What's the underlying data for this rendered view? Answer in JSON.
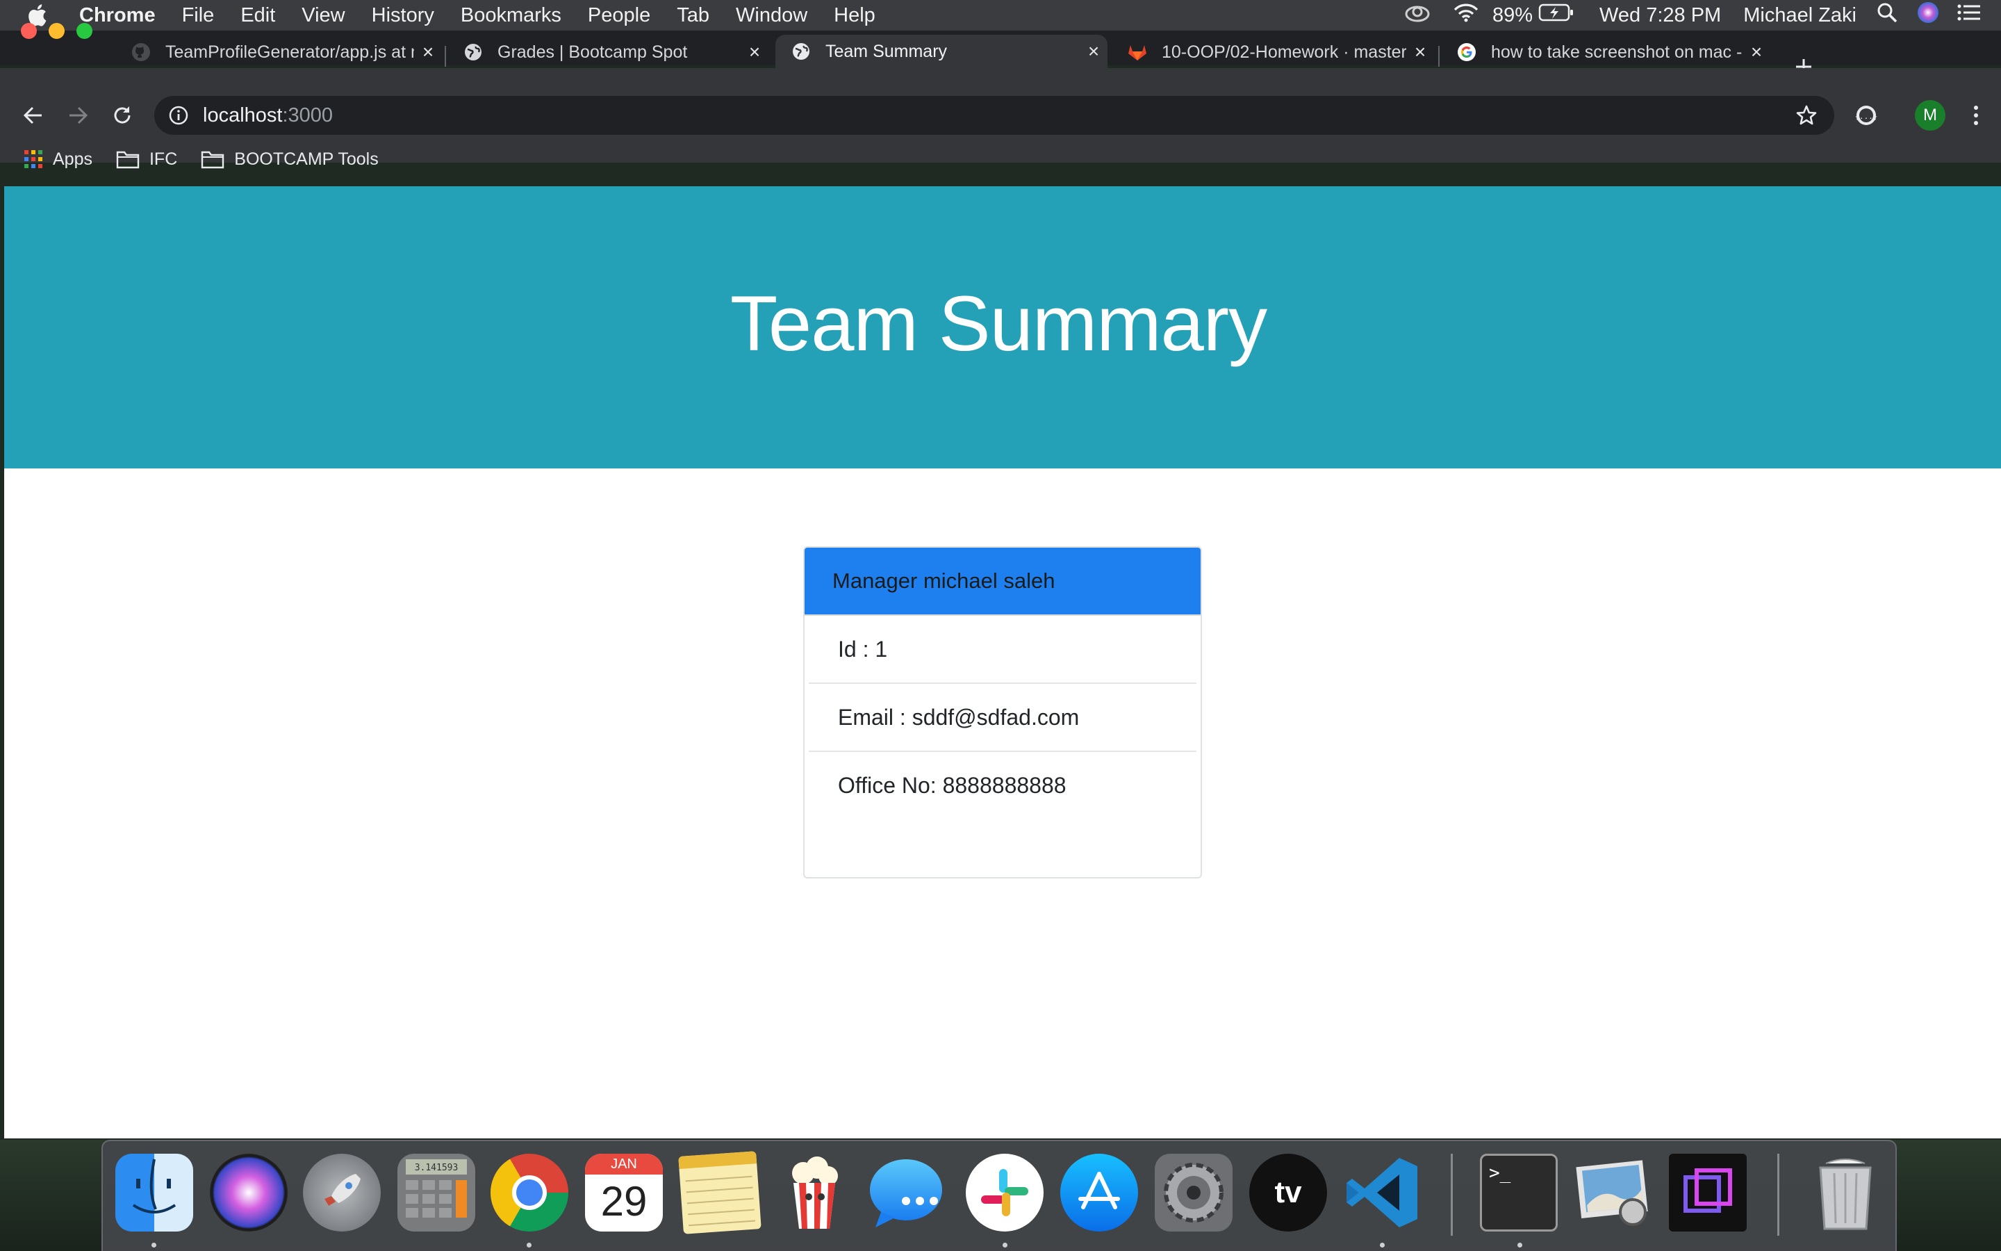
{
  "menubar": {
    "app_name": "Chrome",
    "menus": [
      "File",
      "Edit",
      "View",
      "History",
      "Bookmarks",
      "People",
      "Tab",
      "Window",
      "Help"
    ],
    "battery": "89%",
    "clock": "Wed 7:28 PM",
    "user": "Michael Zaki"
  },
  "tabs": [
    {
      "title": "TeamProfileGenerator/app.js at m",
      "favicon": "github-icon",
      "active": false
    },
    {
      "title": "Grades | Bootcamp Spot",
      "favicon": "globe-icon",
      "active": false
    },
    {
      "title": "Team Summary",
      "favicon": "globe-icon",
      "active": true
    },
    {
      "title": "10-OOP/02-Homework · master",
      "favicon": "gitlab-icon",
      "active": false
    },
    {
      "title": "how to take screenshot on mac -",
      "favicon": "google-icon",
      "active": false
    }
  ],
  "address_bar": {
    "host": "localhost",
    "port": ":3000"
  },
  "profile_initial": "M",
  "bookmarks": [
    {
      "label": "Apps",
      "icon": "apps-grid-icon"
    },
    {
      "label": "IFC",
      "icon": "folder-icon"
    },
    {
      "label": "BOOTCAMP Tools",
      "icon": "folder-icon"
    }
  ],
  "page": {
    "heading": "Team Summary",
    "card": {
      "header": "Manager michael saleh",
      "id_line": "Id : 1",
      "email_line": "Email : sddf@sdfad.com",
      "office_line": "Office No: 8888888888"
    }
  },
  "dock": {
    "calendar_month": "JAN",
    "calendar_day": "29",
    "calculator_display": "3.141593",
    "apps": [
      "finder",
      "siri",
      "launchpad",
      "calculator",
      "chrome",
      "calendar",
      "notes",
      "popcorn-time",
      "messages",
      "slack",
      "app-store",
      "system-preferences",
      "apple-tv",
      "vs-code",
      "terminal",
      "preview",
      "screen-recorder",
      "trash"
    ]
  },
  "colors": {
    "jumbotron": "#24a1b7",
    "card_header": "#1e80ef",
    "chrome_dark": "#202124",
    "chrome_toolbar": "#35363a"
  }
}
